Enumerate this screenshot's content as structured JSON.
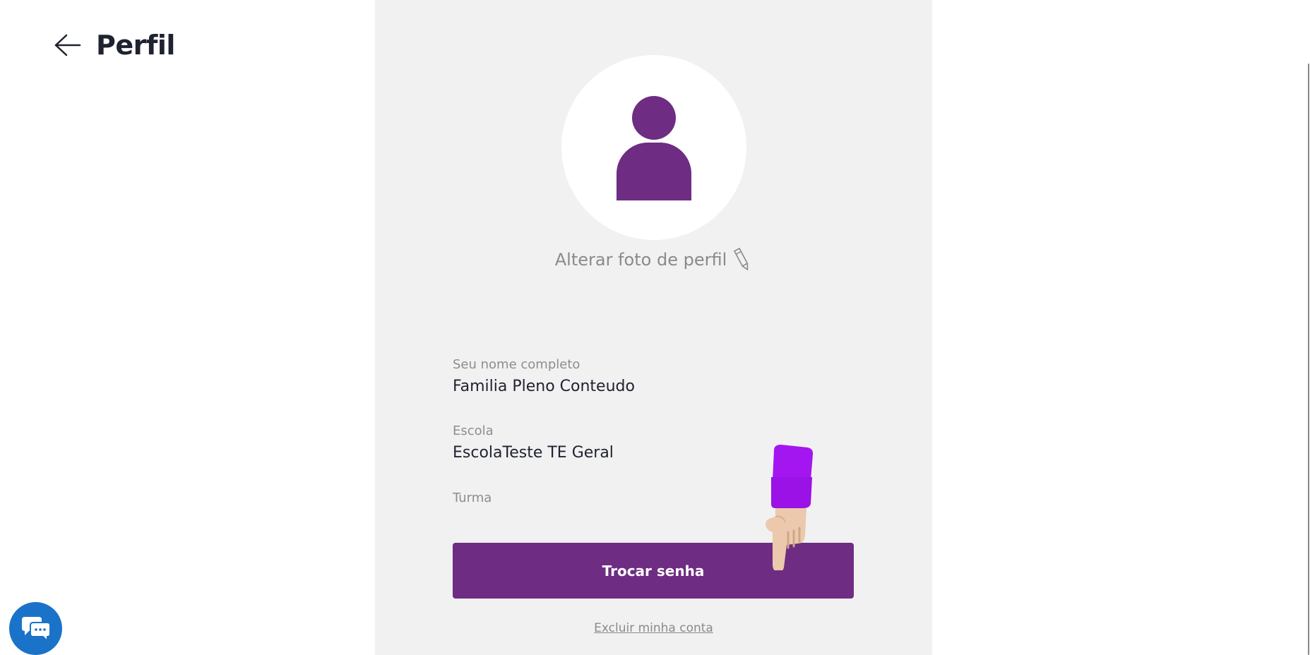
{
  "header": {
    "title": "Perfil",
    "back_icon": "arrow-left-icon"
  },
  "profile": {
    "avatar_icon": "user-silhouette-icon",
    "change_photo_label": "Alterar foto de perfil",
    "change_photo_icon": "pencil-icon"
  },
  "fields": [
    {
      "label": "Seu nome completo",
      "value": "Familia Pleno Conteudo"
    },
    {
      "label": "Escola",
      "value": "EscolaTeste TE Geral"
    },
    {
      "label": "Turma",
      "value": ""
    }
  ],
  "actions": {
    "change_password_label": "Trocar senha",
    "delete_account_label": "Excluir minha conta"
  },
  "chat": {
    "icon": "chat-bubbles-icon"
  },
  "colors": {
    "primary": "#6e2c83",
    "panel_bg": "#f1f1f1",
    "chat_blue": "#1a73c8",
    "hand_sleeve": "#a416f0"
  }
}
